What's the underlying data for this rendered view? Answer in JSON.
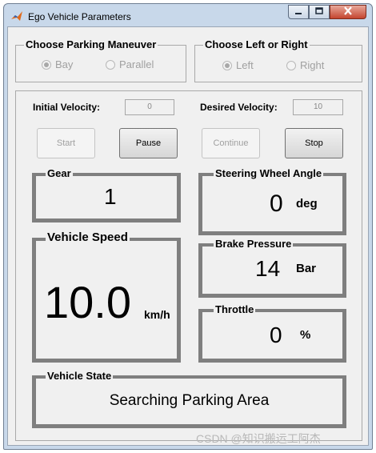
{
  "window": {
    "title": "Ego Vehicle Parameters",
    "controls": {
      "minimize_icon": "minimize-icon",
      "maximize_icon": "maximize-icon",
      "close_icon": "close-icon"
    }
  },
  "maneuver": {
    "title": "Choose Parking Maneuver",
    "options": [
      {
        "label": "Bay",
        "selected": true
      },
      {
        "label": "Parallel",
        "selected": false
      }
    ]
  },
  "side": {
    "title": "Choose Left or Right",
    "options": [
      {
        "label": "Left",
        "selected": true
      },
      {
        "label": "Right",
        "selected": false
      }
    ]
  },
  "velocity": {
    "initial_label": "Initial Velocity:",
    "initial_value": "0",
    "desired_label": "Desired Velocity:",
    "desired_value": "10"
  },
  "buttons": {
    "start": "Start",
    "pause": "Pause",
    "continue": "Continue",
    "stop": "Stop"
  },
  "gear": {
    "title": "Gear",
    "value": "1"
  },
  "steering": {
    "title": "Steering Wheel Angle",
    "value": "0",
    "unit": "deg"
  },
  "speed": {
    "title": "Vehicle Speed",
    "value": "10.0",
    "unit": "km/h"
  },
  "brake": {
    "title": "Brake Pressure",
    "value": "14",
    "unit": "Bar"
  },
  "throttle": {
    "title": "Throttle",
    "value": "0",
    "unit": "%"
  },
  "state": {
    "title": "Vehicle State",
    "value": "Searching Parking Area"
  },
  "watermark": "CSDN @知识搬运工阿杰",
  "colors": {
    "window_frame": "#c8d8ea",
    "client_bg": "#f0f0f0",
    "panel_border": "#7f7f7f",
    "close_button": "#c4452f"
  }
}
